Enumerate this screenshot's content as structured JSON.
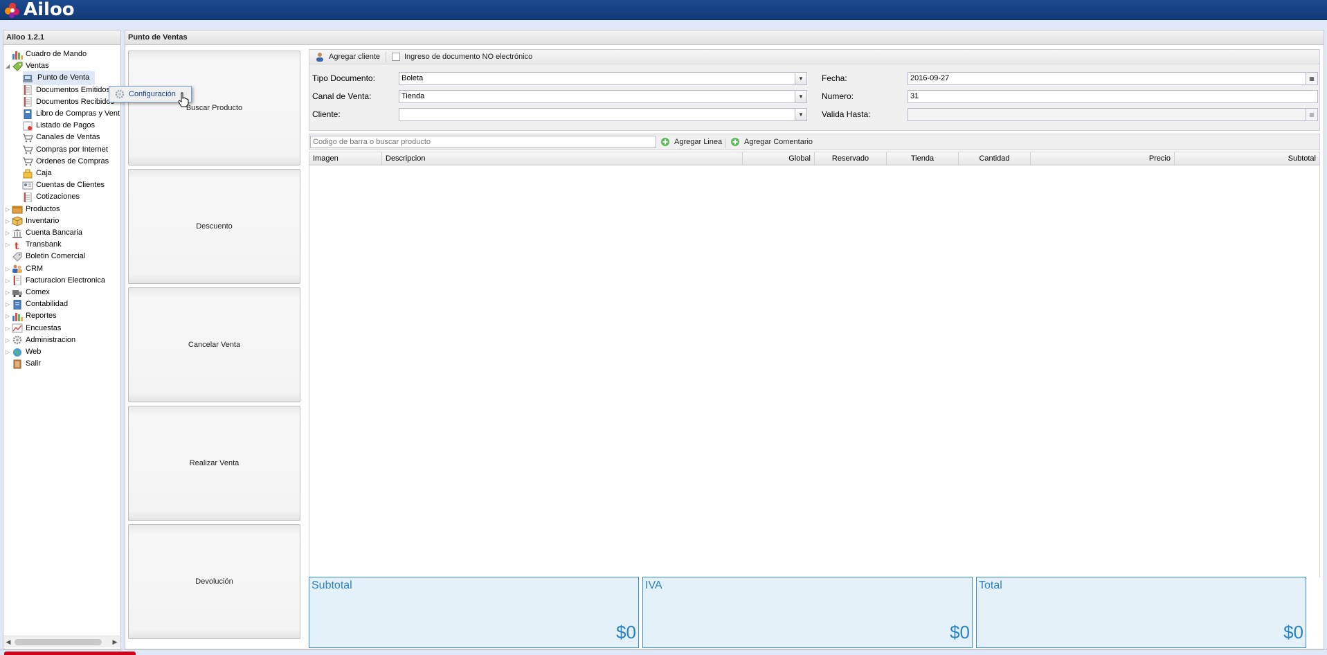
{
  "app": {
    "logo_text": "Ailoo",
    "brand_color": "#1c4a8e"
  },
  "left_panel": {
    "title": "Ailoo 1.2.1"
  },
  "tree": [
    {
      "label": "Cuadro de Mando",
      "icon": "dashboard-chart-icon",
      "level": 0,
      "expander": ""
    },
    {
      "label": "Ventas",
      "icon": "sales-tag-icon",
      "level": 0,
      "expander": "expanded"
    },
    {
      "label": "Punto de Venta",
      "icon": "pos-terminal-icon",
      "level": 1,
      "expander": "",
      "selected": true
    },
    {
      "label": "Documentos Emitidos",
      "icon": "document-icon",
      "level": 1,
      "expander": ""
    },
    {
      "label": "Documentos Recibidos",
      "icon": "document-icon",
      "level": 1,
      "expander": ""
    },
    {
      "label": "Libro de Compras y Ventas",
      "icon": "book-icon",
      "level": 1,
      "expander": ""
    },
    {
      "label": "Listado de Pagos",
      "icon": "payments-icon",
      "level": 1,
      "expander": ""
    },
    {
      "label": "Canales de Ventas",
      "icon": "cart-icon",
      "level": 1,
      "expander": ""
    },
    {
      "label": "Compras por Internet",
      "icon": "cart-icon",
      "level": 1,
      "expander": ""
    },
    {
      "label": "Ordenes de Compras",
      "icon": "cart-icon",
      "level": 1,
      "expander": ""
    },
    {
      "label": "Caja",
      "icon": "cash-register-icon",
      "level": 1,
      "expander": ""
    },
    {
      "label": "Cuentas de Clientes",
      "icon": "client-account-icon",
      "level": 1,
      "expander": ""
    },
    {
      "label": "Cotizaciones",
      "icon": "document-icon",
      "level": 1,
      "expander": ""
    },
    {
      "label": "Productos",
      "icon": "products-box-icon",
      "level": 0,
      "expander": "collapsed"
    },
    {
      "label": "Inventario",
      "icon": "inventory-box-icon",
      "level": 0,
      "expander": "collapsed"
    },
    {
      "label": "Cuenta Bancaria",
      "icon": "bank-icon",
      "level": 0,
      "expander": "collapsed"
    },
    {
      "label": "Transbank",
      "icon": "transbank-icon",
      "level": 0,
      "expander": "collapsed"
    },
    {
      "label": "Boletin Comercial",
      "icon": "tag-icon",
      "level": 0,
      "expander": ""
    },
    {
      "label": "CRM",
      "icon": "crm-users-icon",
      "level": 0,
      "expander": "collapsed"
    },
    {
      "label": "Facturacion Electronica",
      "icon": "invoice-icon",
      "level": 0,
      "expander": "collapsed"
    },
    {
      "label": "Comex",
      "icon": "truck-icon",
      "level": 0,
      "expander": "collapsed"
    },
    {
      "label": "Contabilidad",
      "icon": "ledger-icon",
      "level": 0,
      "expander": "collapsed"
    },
    {
      "label": "Reportes",
      "icon": "reports-chart-icon",
      "level": 0,
      "expander": "collapsed"
    },
    {
      "label": "Encuestas",
      "icon": "survey-chart-icon",
      "level": 0,
      "expander": "collapsed"
    },
    {
      "label": "Administracion",
      "icon": "gear-icon",
      "level": 0,
      "expander": "collapsed"
    },
    {
      "label": "Web",
      "icon": "globe-icon",
      "level": 0,
      "expander": "collapsed"
    },
    {
      "label": "Salir",
      "icon": "exit-icon",
      "level": 0,
      "expander": ""
    }
  ],
  "context_menu": {
    "item_label": "Configuración",
    "icon": "gear-icon"
  },
  "main": {
    "title": "Punto de Ventas",
    "actions": [
      "Buscar Producto",
      "Descuento",
      "Cancelar Venta",
      "Realizar Venta",
      "Devolución"
    ],
    "toolbar": {
      "add_client": "Agregar cliente",
      "non_electronic": "Ingreso de documento NO electrónico"
    },
    "form": {
      "tipo_documento_label": "Tipo Documento:",
      "tipo_documento_value": "Boleta",
      "canal_label": "Canal de Venta:",
      "canal_value": "Tienda",
      "cliente_label": "Cliente:",
      "cliente_value": "",
      "fecha_label": "Fecha:",
      "fecha_value": "2016-09-27",
      "numero_label": "Numero:",
      "numero_value": "31",
      "valida_label": "Valida Hasta:",
      "valida_value": ""
    },
    "product_toolbar": {
      "search_placeholder": "Codigo de barra o buscar producto",
      "add_line": "Agregar Linea",
      "add_comment": "Agregar Comentario"
    },
    "grid_columns": [
      "Imagen",
      "Descripcion",
      "Global",
      "Reservado",
      "Tienda",
      "Cantidad",
      "Precio",
      "Subtotal"
    ],
    "totals": [
      {
        "label": "Subtotal",
        "value": "$0"
      },
      {
        "label": "IVA",
        "value": "$0"
      },
      {
        "label": "Total",
        "value": "$0"
      }
    ]
  }
}
